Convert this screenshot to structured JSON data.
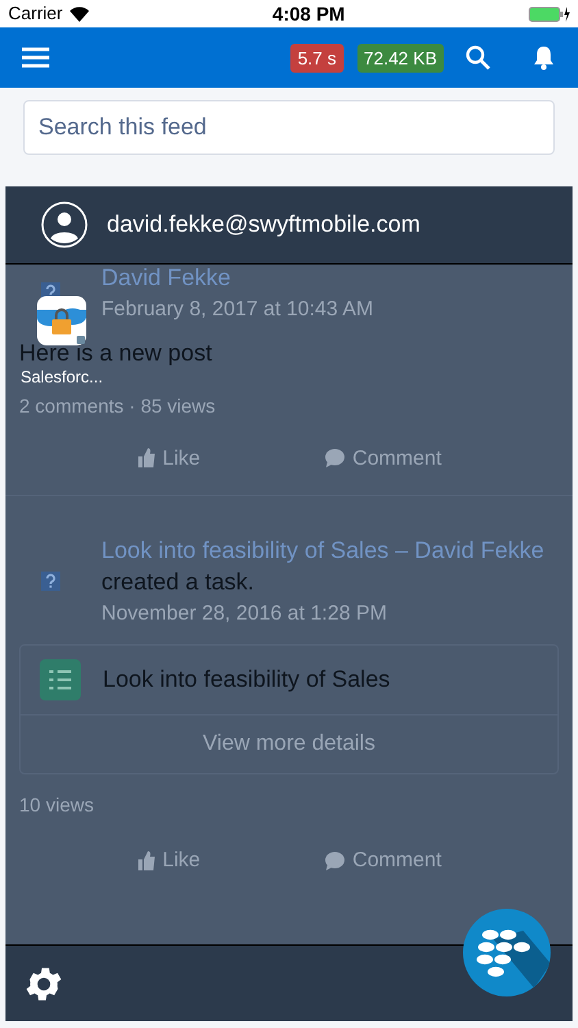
{
  "status_bar": {
    "carrier": "Carrier",
    "time": "4:08 PM"
  },
  "header": {
    "badges": [
      {
        "text": "5.7 s",
        "color": "#c4403e"
      },
      {
        "text": "72.42 KB",
        "color": "#3c8a40"
      }
    ]
  },
  "search": {
    "placeholder": "Search this feed"
  },
  "feed": {
    "posts": [
      {
        "kind": "post",
        "author": "David Fekke",
        "date": "February 8, 2017 at 10:43 AM",
        "body": "Here is a new post",
        "stats": "2 comments · 85 views",
        "actions": [
          "Like",
          "Comment"
        ]
      },
      {
        "kind": "task",
        "link": "Look into feasibility of Sales – David Fekke",
        "tail": "created a task.",
        "date": "November 28, 2016 at 1:28 PM",
        "task": "Look into feasibility of Sales",
        "details": "View more details",
        "stats": "10 views",
        "actions": [
          "Like",
          "Comment"
        ]
      }
    ]
  },
  "drawer": {
    "account": "david.fekke@swyftmobile.com",
    "apps": [
      {
        "label": "Salesforc..."
      }
    ]
  }
}
